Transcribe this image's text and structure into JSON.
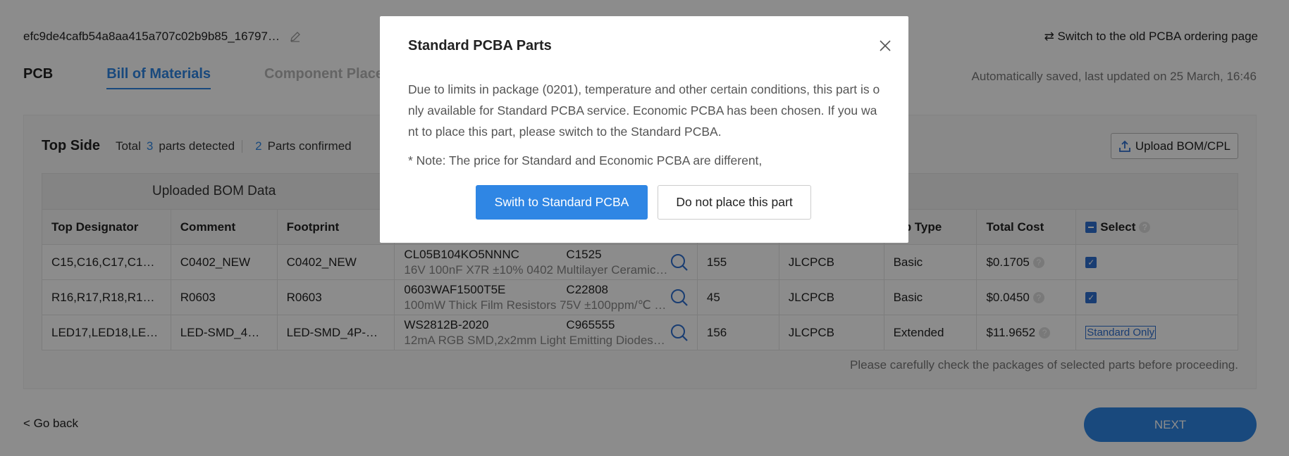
{
  "header": {
    "project_name": "efc9de4cafb54a8aa415a707c02b9b85_16797…",
    "switch_link": "⇄ Switch to the old PCBA ordering page"
  },
  "tabs": [
    {
      "label": "PCB"
    },
    {
      "label": "Bill of Materials"
    },
    {
      "label": "Component Placements"
    }
  ],
  "autosave": "Automatically saved, last updated on 25 March, 16:46",
  "panel": {
    "side": "Top Side",
    "total_label": "Total",
    "total_count": "3",
    "detected_label": "parts detected",
    "confirmed_count": "2",
    "confirmed_label": "Parts confirmed",
    "upload_label": "Upload BOM/CPL",
    "group_header": "Uploaded BOM Data",
    "hint": "Please carefully check the packages of selected parts before proceeding."
  },
  "table": {
    "headers": [
      "Top Designator",
      "Comment",
      "Footprint",
      "",
      "",
      "",
      "Lib Type",
      "Total Cost",
      "Select"
    ],
    "rows": [
      {
        "designator": "C15,C16,C17,C1…",
        "comment": "C0402_NEW",
        "footprint": "C0402_NEW",
        "mpn": "CL05B104KO5NNNC",
        "lcsc": "C1525",
        "desc": "16V 100nF X7R ±10% 0402 Multilayer Ceramic…",
        "qty": "155",
        "supplier": "JLCPCB",
        "lib": "Basic",
        "cost": "$0.1705",
        "select": "checked"
      },
      {
        "designator": "R16,R17,R18,R1…",
        "comment": "R0603",
        "footprint": "R0603",
        "mpn": "0603WAF1500T5E",
        "lcsc": "C22808",
        "desc": "100mW Thick Film Resistors 75V ±100ppm/℃ …",
        "qty": "45",
        "supplier": "JLCPCB",
        "lib": "Basic",
        "cost": "$0.0450",
        "select": "checked"
      },
      {
        "designator": "LED17,LED18,LE…",
        "comment": "LED-SMD_4…",
        "footprint": "LED-SMD_4P-…",
        "mpn": "WS2812B-2020",
        "lcsc": "C965555",
        "desc": "12mA RGB SMD,2x2mm Light Emitting Diodes…",
        "qty": "156",
        "supplier": "JLCPCB",
        "lib": "Extended",
        "cost": "$11.9652",
        "select": "Standard Only"
      }
    ]
  },
  "footer": {
    "back_label": "< Go back",
    "next_label": "NEXT"
  },
  "modal": {
    "title": "Standard PCBA Parts",
    "body": "Due to limits in package (0201), temperature and other certain conditions, this part is only available for Standard PCBA service. Economic PCBA has been chosen. If you want to place this part, please switch to the Standard PCBA.",
    "note": "* Note: The price for Standard and Economic PCBA are different,",
    "primary_label": "Swith to Standard PCBA",
    "secondary_label": "Do not place this part"
  },
  "colors": {
    "accent": "#2f86e4",
    "overlay": "rgba(0,0,0,0.45)"
  }
}
